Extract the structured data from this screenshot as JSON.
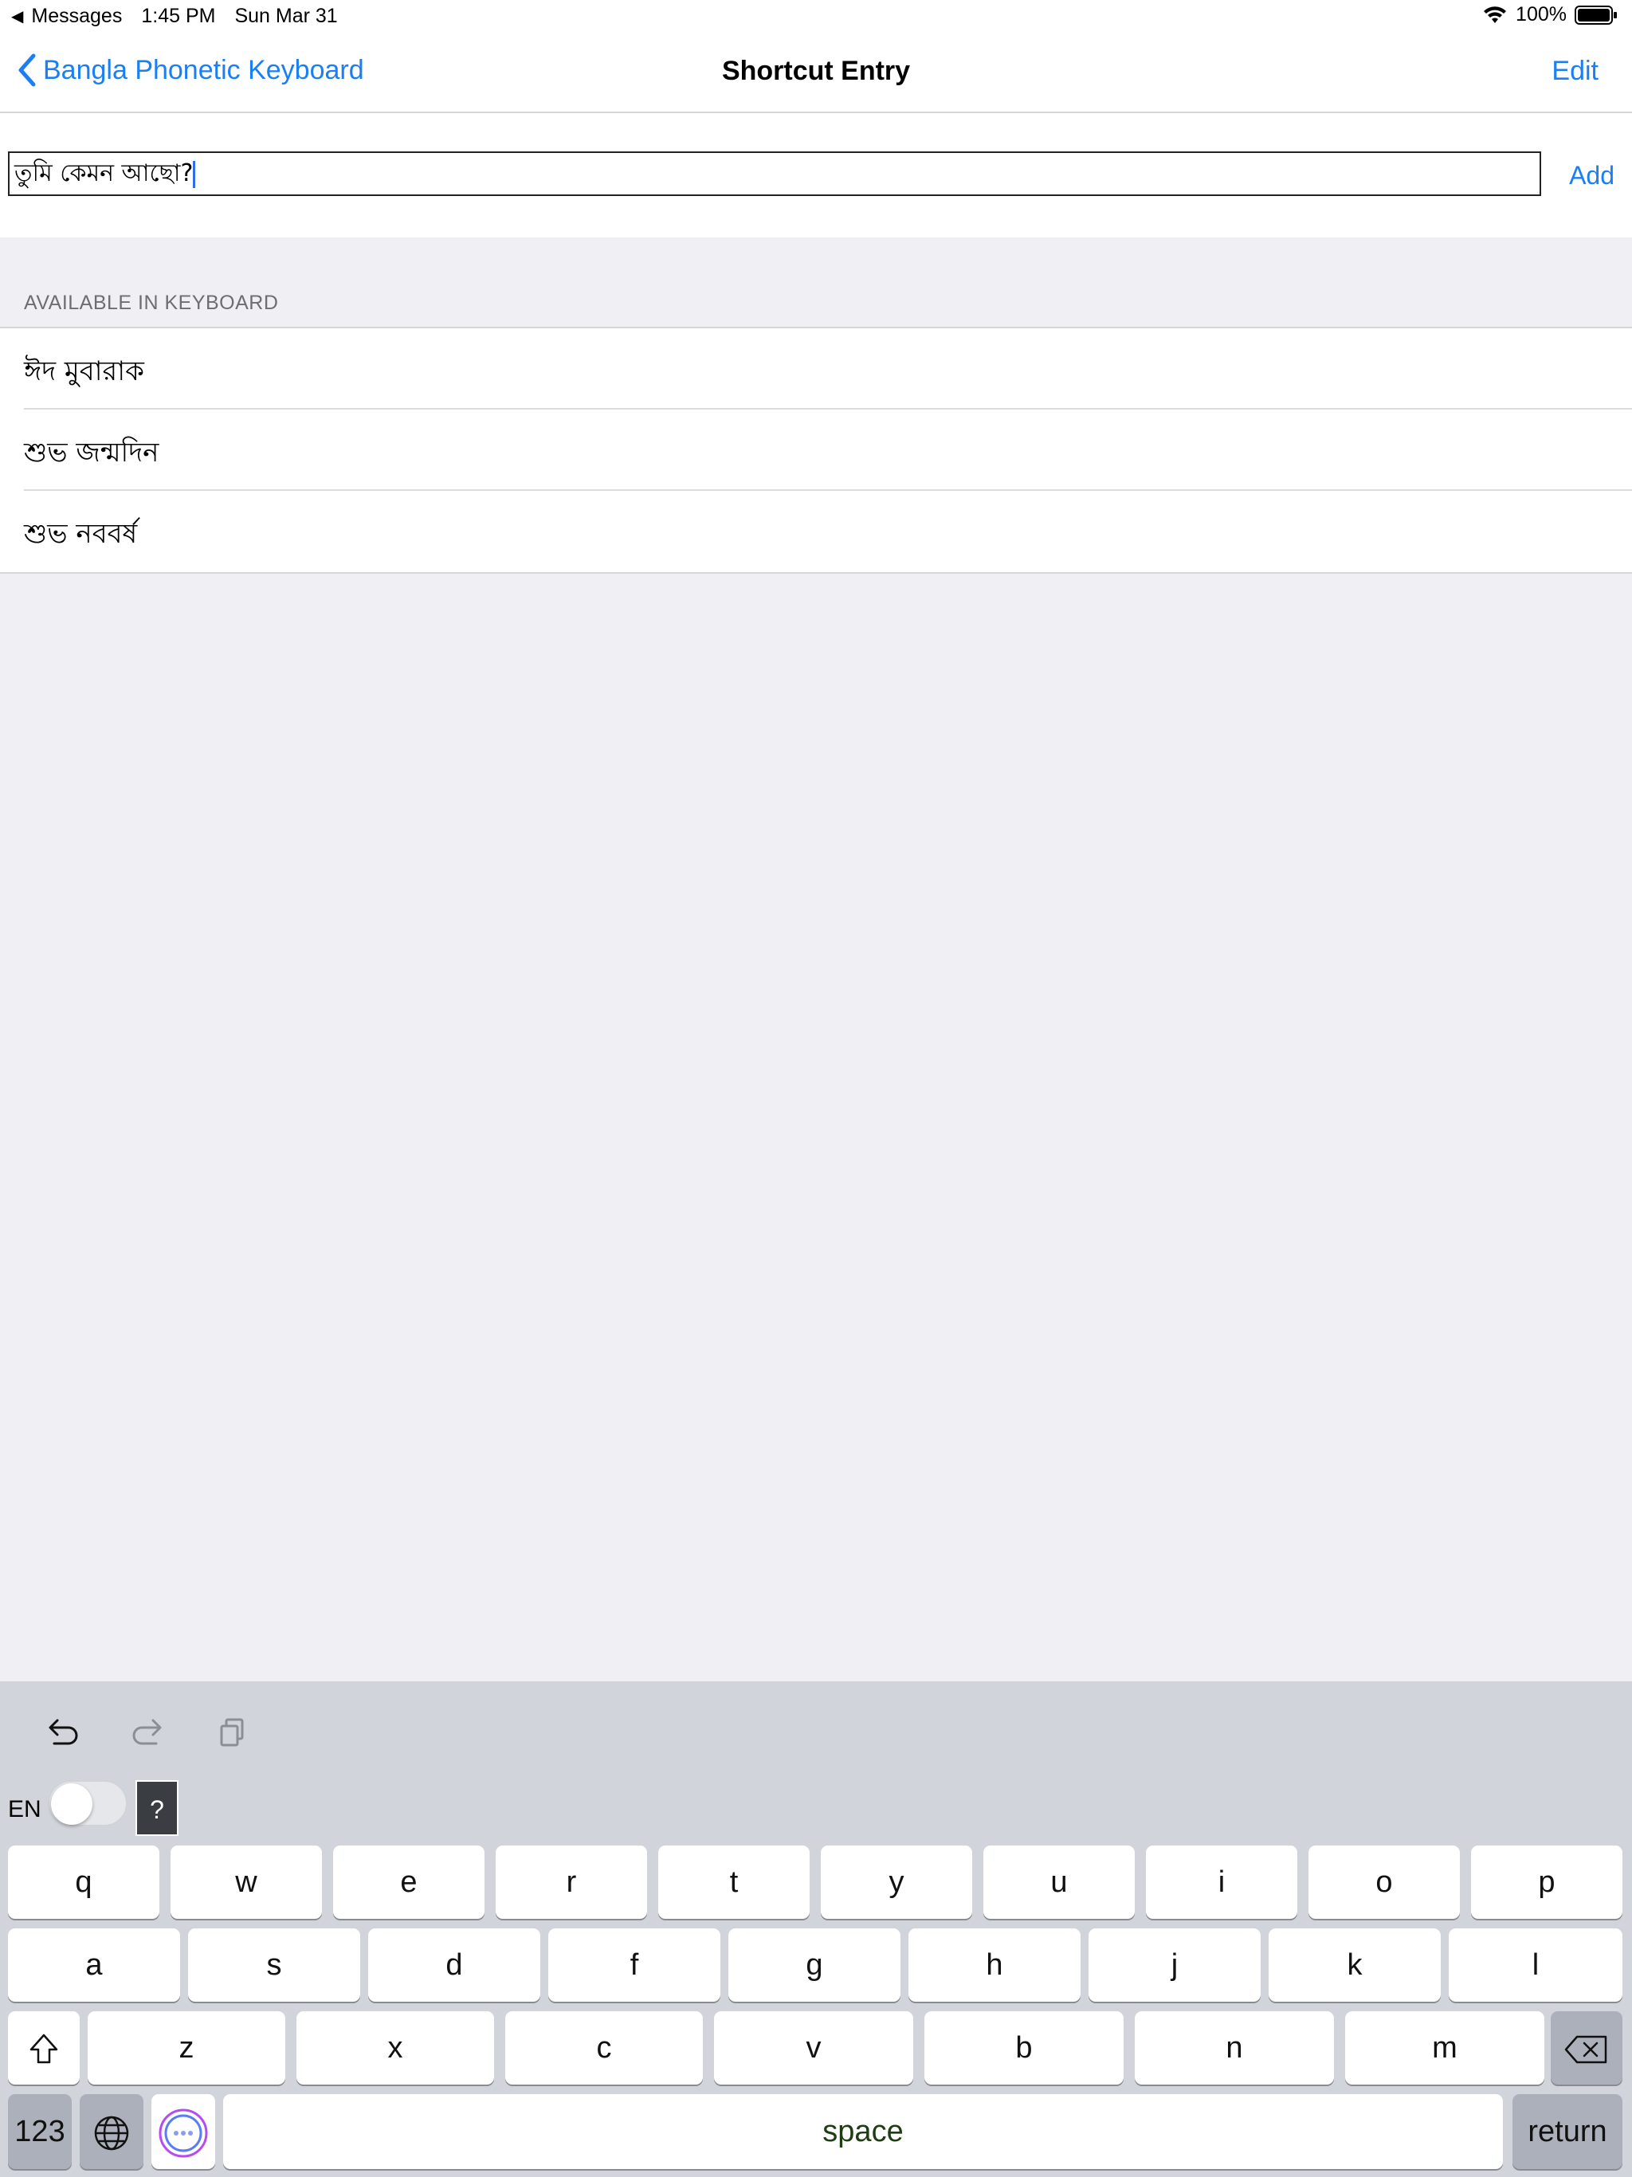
{
  "status": {
    "back_app": "Messages",
    "time": "1:45 PM",
    "date": "Sun Mar 31",
    "battery": "100%"
  },
  "nav": {
    "back_label": "Bangla Phonetic Keyboard",
    "title": "Shortcut Entry",
    "edit_label": "Edit"
  },
  "entry": {
    "value": "তুমি কেমন আছো?",
    "add_label": "Add"
  },
  "section": {
    "header": "AVAILABLE IN KEYBOARD",
    "items": [
      {
        "label": "ঈদ মুবারাক"
      },
      {
        "label": "শুভ জন্মদিন"
      },
      {
        "label": "শুভ নববর্ষ"
      }
    ]
  },
  "keyboard": {
    "lang_label": "EN",
    "help_label": "?",
    "row1": [
      "q",
      "w",
      "e",
      "r",
      "t",
      "y",
      "u",
      "i",
      "o",
      "p"
    ],
    "row2": [
      "a",
      "s",
      "d",
      "f",
      "g",
      "h",
      "j",
      "k",
      "l"
    ],
    "row3": [
      "z",
      "x",
      "c",
      "v",
      "b",
      "n",
      "m"
    ],
    "numbers_label": "123",
    "space_label": "space",
    "return_label": "return"
  }
}
